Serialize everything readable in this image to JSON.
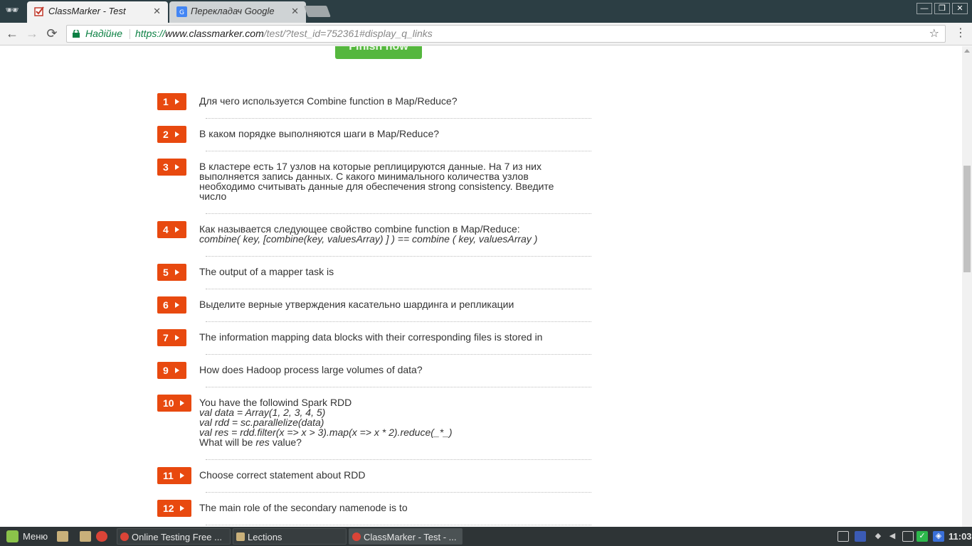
{
  "browser": {
    "tabs": [
      {
        "title": "ClassMarker - Test",
        "close": "✕"
      },
      {
        "title": "Перекладач Google",
        "close": "✕"
      }
    ],
    "window_buttons": {
      "minimize": "—",
      "restore": "❐",
      "close": "✕"
    },
    "nav": {
      "back": "←",
      "forward": "→",
      "reload": "⟳"
    },
    "security_label": "Надійне",
    "url": {
      "scheme": "https://",
      "host": "www.classmarker.com",
      "path": "/test/?test_id=752361#display_q_links"
    },
    "star": "☆",
    "menu": "⋮"
  },
  "page": {
    "finish_button": "Finish now",
    "questions": [
      {
        "num": "1",
        "lines": [
          {
            "t": "Для чего используется Combine function в Map/Reduce?"
          }
        ]
      },
      {
        "num": "2",
        "lines": [
          {
            "t": "В каком порядке выполняются шаги в Map/Reduce?"
          }
        ]
      },
      {
        "num": "3",
        "lines": [
          {
            "t": "В кластере есть 17 узлов на которые реплицируются данные. На 7 из них"
          },
          {
            "t": "выполняется запись данных. С какого минимального количества узлов"
          },
          {
            "t": "необходимо считывать данные для обеспечения strong consistency. Введите"
          },
          {
            "t": "число"
          }
        ]
      },
      {
        "num": "4",
        "lines": [
          {
            "t": "Как называется следующее свойство combine function в Map/Reduce:"
          },
          {
            "t": "combine( key, [combine(key, valuesArray) ] ) == combine ( key, valuesArray )",
            "italic": true
          }
        ]
      },
      {
        "num": "5",
        "lines": [
          {
            "t": "The output of a mapper task is"
          }
        ]
      },
      {
        "num": "6",
        "lines": [
          {
            "t": "Выделите верные утверждения касательно шардинга и репликации"
          }
        ]
      },
      {
        "num": "7",
        "lines": [
          {
            "t": "The information mapping data blocks with their corresponding files is stored in"
          }
        ]
      },
      {
        "num": "9",
        "lines": [
          {
            "t": "How does Hadoop process large volumes of data?"
          }
        ]
      },
      {
        "num": "10",
        "lines": [
          {
            "t": "You have the followind Spark RDD"
          },
          {
            "t": "val data = Array(1, 2, 3, 4, 5)",
            "italic": true
          },
          {
            "t": "val rdd = sc.parallelize(data)",
            "italic": true
          },
          {
            "t": "val res = rdd.filter(x => x > 3).map(x => x * 2).reduce(_*_)",
            "italic": true
          },
          {
            "t": "What will be res value?",
            "mixed": [
              "What will be ",
              "res",
              " value?"
            ]
          }
        ]
      },
      {
        "num": "11",
        "lines": [
          {
            "t": "Choose correct statement about RDD"
          }
        ]
      },
      {
        "num": "12",
        "lines": [
          {
            "t": "The main role of the secondary namenode is to"
          }
        ]
      }
    ]
  },
  "taskbar": {
    "menu_label": "Меню",
    "windows": [
      {
        "title": "Online Testing Free ..."
      },
      {
        "title": "Lections"
      },
      {
        "title": "ClassMarker - Test - ..."
      }
    ],
    "clock": "11:03"
  },
  "colors": {
    "question_badge": "#e8490f",
    "finish_button": "#55b73e",
    "secure_green": "#0b8043"
  }
}
